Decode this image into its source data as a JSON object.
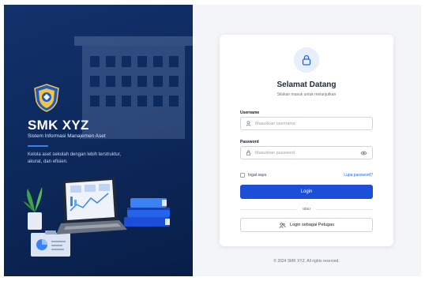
{
  "hero": {
    "school_name": "SMK XYZ",
    "system_name": "Sistem Informasi Manajemen Aset",
    "description": "Kelola aset sekolah dengan lebih terstruktur, akurat, dan efisien."
  },
  "login": {
    "title": "Selamat Datang",
    "subtitle": "Silakan masuk untuk melanjutkan",
    "username_label": "Username",
    "username_placeholder": "Masukkan username",
    "password_label": "Password",
    "password_placeholder": "Masukkan password",
    "remember_label": "Ingat saya",
    "forgot_link": "Lupa password?",
    "login_button": "Login",
    "divider_text": "atau",
    "officer_button": "Login sebagai Petugas"
  },
  "footer": {
    "copyright": "© 2024 SMK XYZ. All rights reserved."
  },
  "colors": {
    "hero_bg": "#0d2a5e",
    "accent": "#1d4ed8",
    "link": "#2563eb"
  },
  "icons": {
    "lock": "lock-icon",
    "user": "user-icon",
    "password": "lock-icon",
    "eye": "eye-icon",
    "officer": "users-icon",
    "logo": "school-shield-logo"
  }
}
